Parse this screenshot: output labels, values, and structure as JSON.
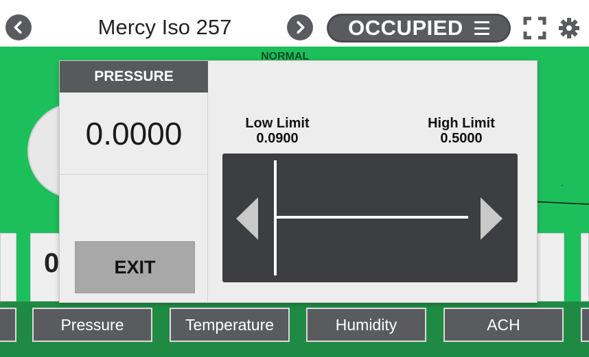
{
  "header": {
    "room_name": "Mercy Iso 257",
    "status": "OCCUPIED",
    "prev_icon": "chevron-left-icon",
    "next_icon": "chevron-right-icon",
    "menu_icon": "hamburger-menu-icon",
    "fullscreen_icon": "fullscreen-icon",
    "settings_icon": "gear-icon"
  },
  "background": {
    "status_label": "NORMAL",
    "tile_value_fragment": "0"
  },
  "tabs": [
    {
      "label": "Pressure"
    },
    {
      "label": "Temperature"
    },
    {
      "label": "Humidity"
    },
    {
      "label": "ACH"
    }
  ],
  "modal": {
    "title": "PRESSURE",
    "value": "0.0000",
    "exit_label": "EXIT",
    "low_limit": {
      "label": "Low Limit",
      "value": "0.0900"
    },
    "high_limit": {
      "label": "High Limit",
      "value": "0.5000"
    }
  },
  "colors": {
    "normal_green": "#1dbf5b",
    "dark_gray": "#5a5b5e",
    "slider_bg": "#3d3e41"
  }
}
